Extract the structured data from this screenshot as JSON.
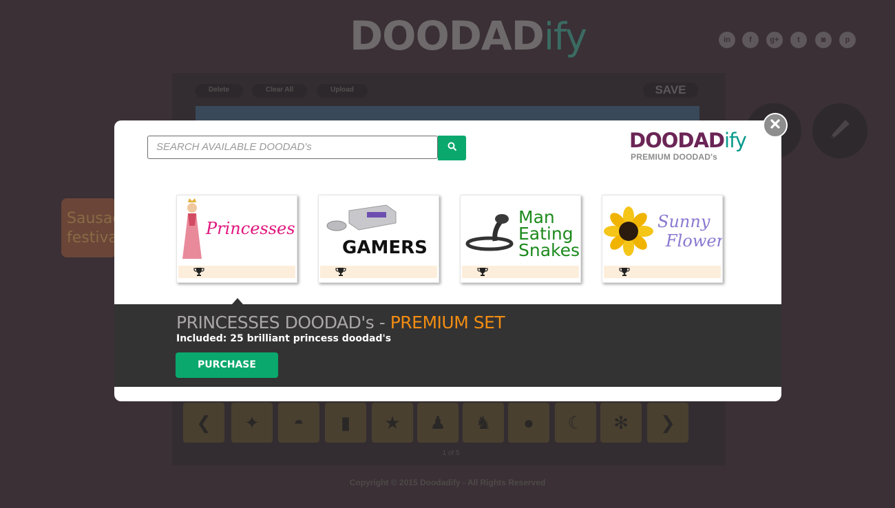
{
  "background": {
    "logo": {
      "main": "DOODAD",
      "suffix": "ify"
    },
    "social_icons": [
      "linkedin-icon",
      "facebook-icon",
      "google-plus-icon",
      "twitter-icon",
      "instagram-icon",
      "pinterest-icon"
    ],
    "toolbar": {
      "delete_label": "Delete",
      "clear_all_label": "Clear All",
      "upload_label": "Upload",
      "save_label": "SAVE"
    },
    "note_text": "Sausage festival!",
    "pager": "1 of 5",
    "copyright": "Copyright © 2015 Doodadify - All Rights Reserved"
  },
  "modal": {
    "search_placeholder": "SEARCH AVAILABLE DOODAD's",
    "brand": {
      "title": "DOODAD",
      "suffix": "ify",
      "subtitle": "PREMIUM DOODAD's"
    },
    "cards": [
      {
        "label": "Princesses",
        "icon": "trophy-icon"
      },
      {
        "label": "GAMERS",
        "icon": "trophy-icon"
      },
      {
        "label": "Man Eating Snakes",
        "icon": "trophy-icon"
      },
      {
        "label": "Sunny Flowers",
        "icon": "trophy-icon"
      }
    ],
    "detail": {
      "title_prefix": "PRINCESSES DOODAD's - ",
      "title_highlight": "PREMIUM SET",
      "included": "Included: 25 brilliant princess doodad's",
      "purchase_label": "PURCHASE"
    }
  },
  "colors": {
    "accent_green": "#0aa86d",
    "premium_orange": "#f28c12",
    "brand_purple": "#6b2556",
    "card_footer": "#fdeedc"
  }
}
